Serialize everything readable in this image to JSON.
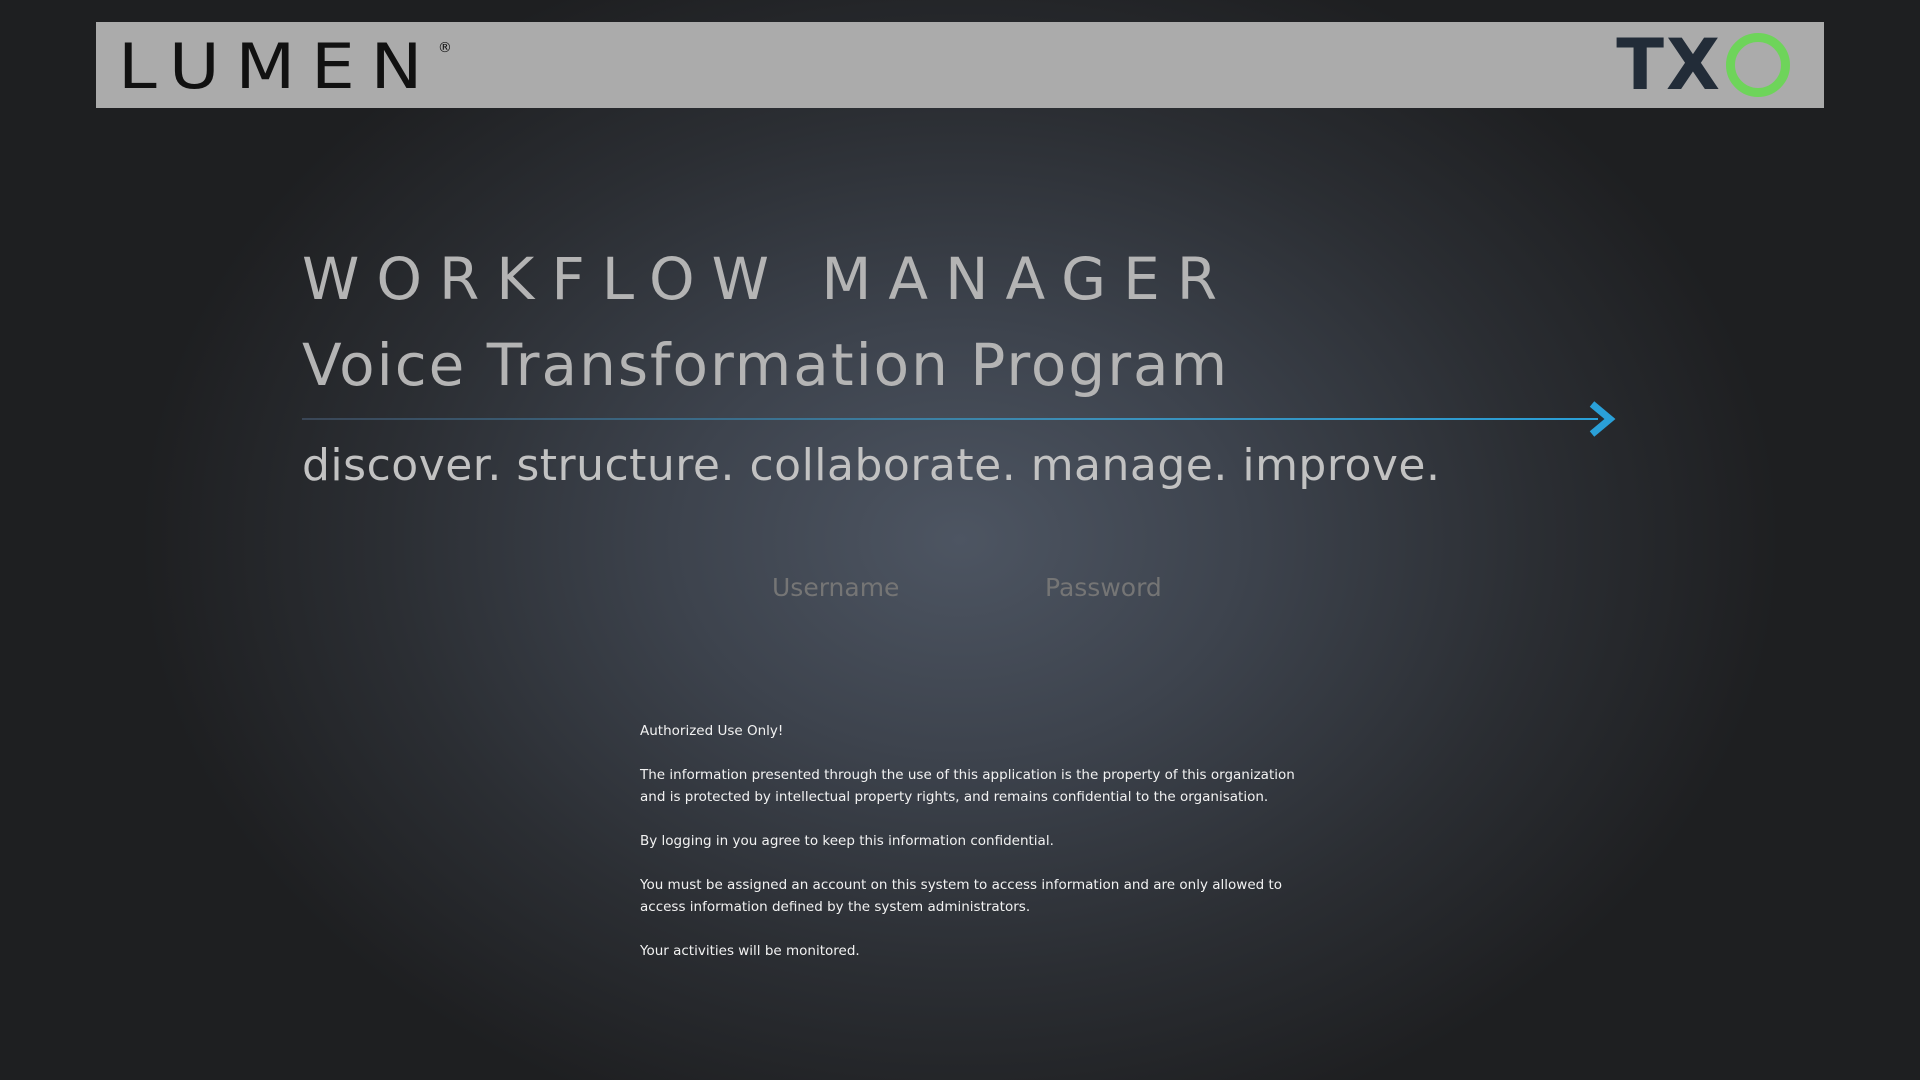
{
  "header": {
    "logo_left": "LUMEN",
    "logo_left_mark": "®",
    "logo_right": "TX",
    "logo_right_ring": "O",
    "colors": {
      "header_bg": "#ababab",
      "lumen_accent": "#2aa0d8",
      "txo_text": "#222c38",
      "txo_ring": "#6ed45a"
    }
  },
  "hero": {
    "title": "WORKFLOW MANAGER",
    "subtitle": "Voice Transformation Program",
    "tagline": "discover. structure. collaborate. manage. improve.",
    "arrow_color": "#2aa0d8"
  },
  "login": {
    "username_placeholder": "Username",
    "password_placeholder": "Password"
  },
  "notice": {
    "heading": "Authorized Use Only!",
    "paragraphs": [
      "The information presented through the use of this application is the property of this organization and is protected by intellectual property rights, and remains confidential to the organisation.",
      "By logging in you agree to keep this information confidential.",
      "You must be assigned an account on this system to access information and are only allowed to access information defined by the system administrators.",
      "Your activities will be monitored."
    ]
  }
}
